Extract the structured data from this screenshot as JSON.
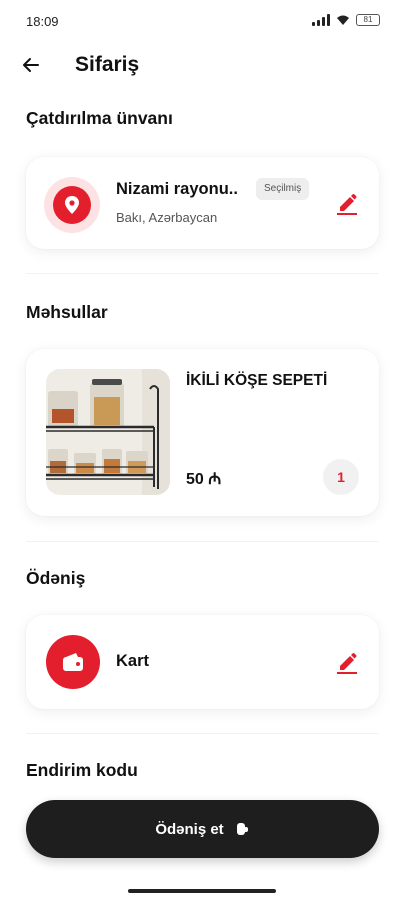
{
  "status_bar": {
    "time": "18:09",
    "battery": "81"
  },
  "header": {
    "title": "Sifariş"
  },
  "address_section": {
    "title": "Çatdırılma ünvanı",
    "name": "Nizami rayonu..",
    "badge": "Seçilmiş",
    "city": "Bakı, Azərbaycan"
  },
  "products_section": {
    "title": "Məhsullar",
    "items": [
      {
        "name": "İKİLİ KÖŞE SEPETİ",
        "price": "50 ₼",
        "quantity": "1"
      }
    ]
  },
  "payment_section": {
    "title": "Ödəniş",
    "method": "Kart"
  },
  "discount_section": {
    "title": "Endirim kodu"
  },
  "footer": {
    "pay_button_label": "Ödəniş et"
  },
  "colors": {
    "accent": "#e31e2d",
    "button_dark": "#1e1e1e",
    "badge_bg": "#eeeeee"
  }
}
